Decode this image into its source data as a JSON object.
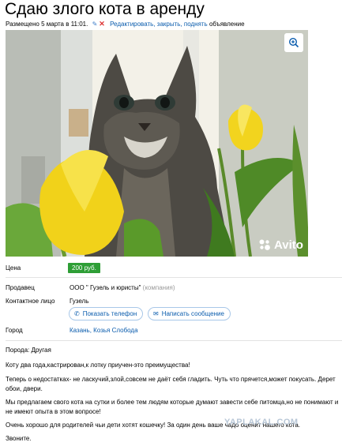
{
  "header": {
    "title": "Сдаю злого кота в аренду",
    "posted": "Размещено 5 марта в 11:01.",
    "edit_link": "Редактировать, закрыть, поднять",
    "edit_suffix": "объявление"
  },
  "photo": {
    "brand": "Avito"
  },
  "details": {
    "price_label": "Цена",
    "price_value": "200 руб.",
    "seller_label": "Продавец",
    "seller_value": "ООО \" Гузель и юристы\"",
    "seller_hint": "(компания)",
    "contact_label": "Контактное лицо",
    "contact_value": "Гузель",
    "show_phone_label": "Показать телефон",
    "write_message_label": "Написать сообщение",
    "city_label": "Город",
    "city_value": "Казань, Козья Слобода"
  },
  "description": {
    "breed": "Порода: Другая",
    "p1": "Коту два года,кастрирован,к лотку приучен-это преимущества!",
    "p2": "Теперь о недостатках- не ласкучий,злой,совсем не даёт себя гладить. Чуть что прячется,может покусать. Дерет обои, двери.",
    "p3": "Мы предлагаем свого кота на сутки и более тем людям которые думают завести себе питомца,но не понимают и не имеют опыта в этом вопросе!",
    "p4": "Очень хорошо для родителей чьи дети хотят кошечку! За один день ваше чадо оценит нашего кота.",
    "p5": "Звоните."
  },
  "watermark": "YAPLAKAL.COM",
  "colors": {
    "link": "#0a5cad",
    "price_badge": "#2e9e36",
    "divider": "#e3e3e3"
  },
  "icons": {
    "zoom": "zoom-in-icon",
    "phone": "phone-icon",
    "message": "envelope-icon",
    "edit": "pencil-icon",
    "close": "close-icon"
  }
}
